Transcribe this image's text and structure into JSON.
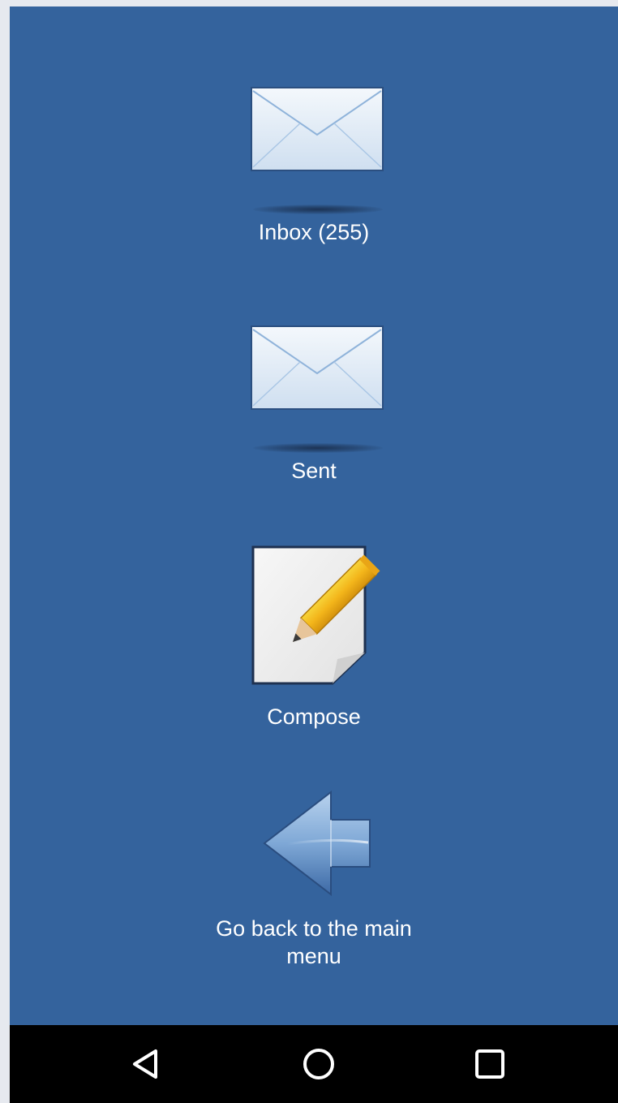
{
  "menu": {
    "inbox": {
      "label": "Inbox (255)",
      "icon": "envelope-icon"
    },
    "sent": {
      "label": "Sent",
      "icon": "envelope-icon"
    },
    "compose": {
      "label": "Compose",
      "icon": "pencil-paper-icon"
    },
    "back": {
      "label": "Go back to the main\nmenu",
      "icon": "back-arrow-icon"
    }
  },
  "navbar": {
    "back_icon": "triangle-back-icon",
    "home_icon": "circle-home-icon",
    "recents_icon": "square-recents-icon"
  },
  "colors": {
    "background": "#34639d",
    "navbar": "#000000",
    "label": "#ffffff",
    "pencil": "#f5c518"
  }
}
